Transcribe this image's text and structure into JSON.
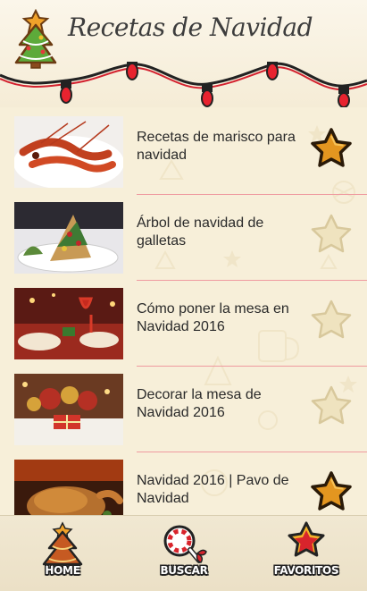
{
  "header": {
    "title": "Recetas de Navidad"
  },
  "recipes": [
    {
      "label": "Recetas de marisco para navidad",
      "favorite": true,
      "image": "shrimp-photo"
    },
    {
      "label": "Árbol de navidad de galletas",
      "favorite": false,
      "image": "cookie-tree-photo"
    },
    {
      "label": "Cómo poner la mesa en Navidad 2016",
      "favorite": false,
      "image": "table-setting-photo"
    },
    {
      "label": "Decorar la mesa de Navidad 2016",
      "favorite": false,
      "image": "table-decor-photo"
    },
    {
      "label": "Navidad 2016 | Pavo de Navidad",
      "favorite": true,
      "image": "turkey-photo"
    }
  ],
  "nav": {
    "home_label": "HOME",
    "search_label": "BUSCAR",
    "favorites_label": "FAVORITOS"
  },
  "colors": {
    "background": "#f7efd9",
    "divider": "#ef9aa0",
    "star_active": "#e39620",
    "star_inactive": "#efe3bf"
  }
}
